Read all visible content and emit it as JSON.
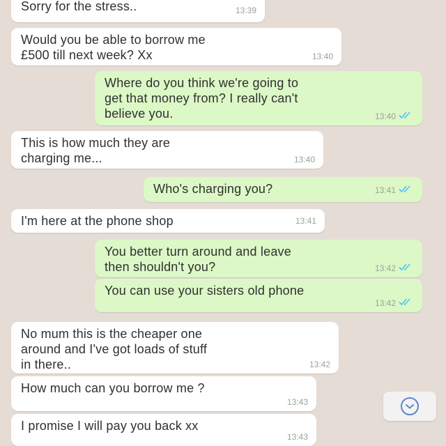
{
  "colors": {
    "background": "#e5ddd5",
    "incoming_bubble": "#ffffff",
    "outgoing_bubble": "#dcf8c6",
    "read_ticks": "#4fc3f7"
  },
  "icons": {
    "read_receipt": "double-check-icon",
    "scroll_down": "chevron-down-icon"
  },
  "messages": [
    {
      "direction": "in",
      "text": "Sorry for the stress..",
      "time": "13:39"
    },
    {
      "direction": "in",
      "text": "Would you be able to borrow me\n£500 till next week? Xx",
      "time": "13:40"
    },
    {
      "direction": "out",
      "text": "Where do you think we're going to\nget that money from? I really can't\nbelieve you.",
      "time": "13:40",
      "read": true
    },
    {
      "direction": "in",
      "text": "This is how much they are\ncharging me...",
      "time": "13:40"
    },
    {
      "direction": "out",
      "text": "Who's charging you?",
      "time": "13:41",
      "read": true
    },
    {
      "direction": "in",
      "text": "I'm here at the phone shop",
      "time": "13:41"
    },
    {
      "direction": "out",
      "text": "You better turn around and leave\nthen shouldn't you?",
      "time": "13:42",
      "read": true
    },
    {
      "direction": "out",
      "text": "You can use your sisters old phone",
      "time": "13:42",
      "read": true
    },
    {
      "direction": "in",
      "text": "No mum this is the cheaper one\naround and I've got loads of stuff\nin there..",
      "time": "13:42"
    },
    {
      "direction": "in",
      "text": "How much can you borrow me ?",
      "time": "13:43"
    },
    {
      "direction": "in",
      "text": "I promise I will pay you back xx",
      "time": "13:43"
    }
  ]
}
